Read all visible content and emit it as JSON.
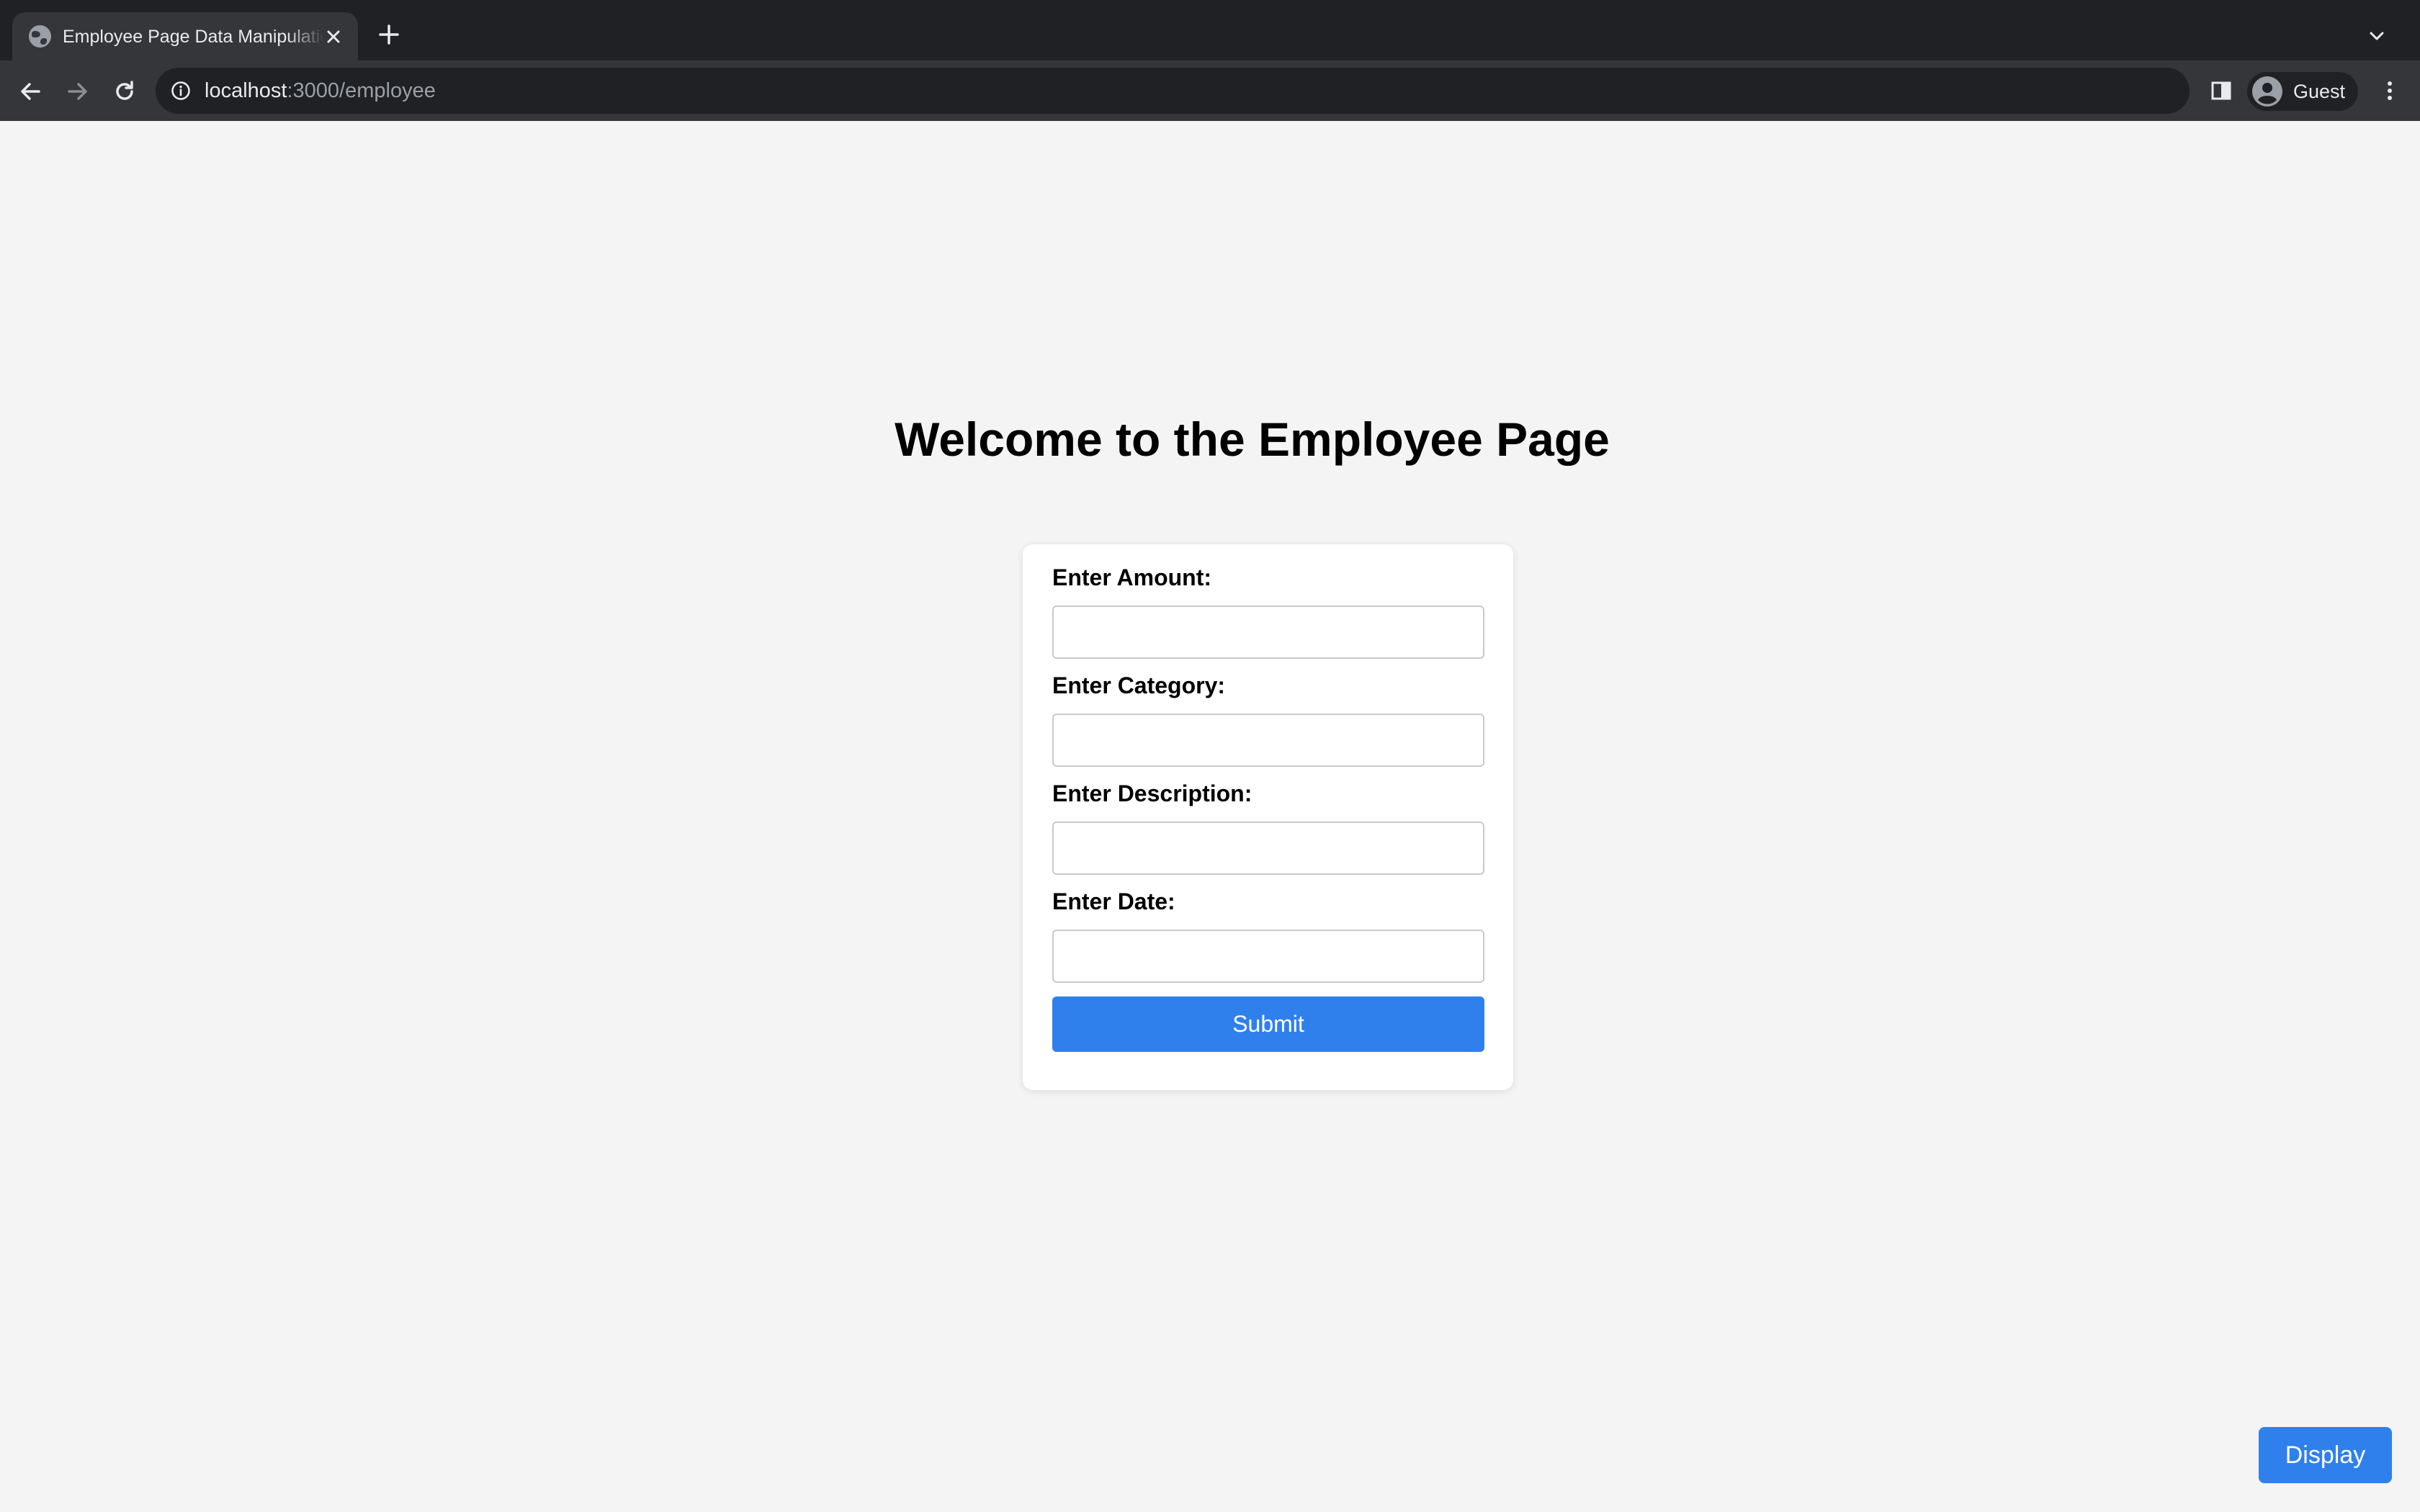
{
  "browser": {
    "tab": {
      "title": "Employee Page Data Manipulation"
    },
    "address_bar": {
      "host": "localhost",
      "path": ":3000/employee"
    },
    "profile": {
      "name": "Guest"
    },
    "icons": [
      "globe-icon",
      "close-icon",
      "plus-icon",
      "chevron-down-icon",
      "back-arrow-icon",
      "forward-arrow-icon",
      "reload-icon",
      "info-icon",
      "side-panel-icon",
      "avatar-icon",
      "kebab-menu-icon"
    ]
  },
  "page": {
    "title": "Welcome to the Employee Page",
    "form": {
      "fields": [
        {
          "label": "Enter Amount:",
          "value": ""
        },
        {
          "label": "Enter Category:",
          "value": ""
        },
        {
          "label": "Enter Description:",
          "value": ""
        },
        {
          "label": "Enter Date:",
          "value": ""
        }
      ],
      "submit_label": "Submit"
    },
    "display_label": "Display"
  },
  "colors": {
    "primary_button": "#2f80ed",
    "page_background": "#f4f4f4",
    "chrome_dark": "#202124",
    "chrome_toolbar": "#35363a"
  }
}
